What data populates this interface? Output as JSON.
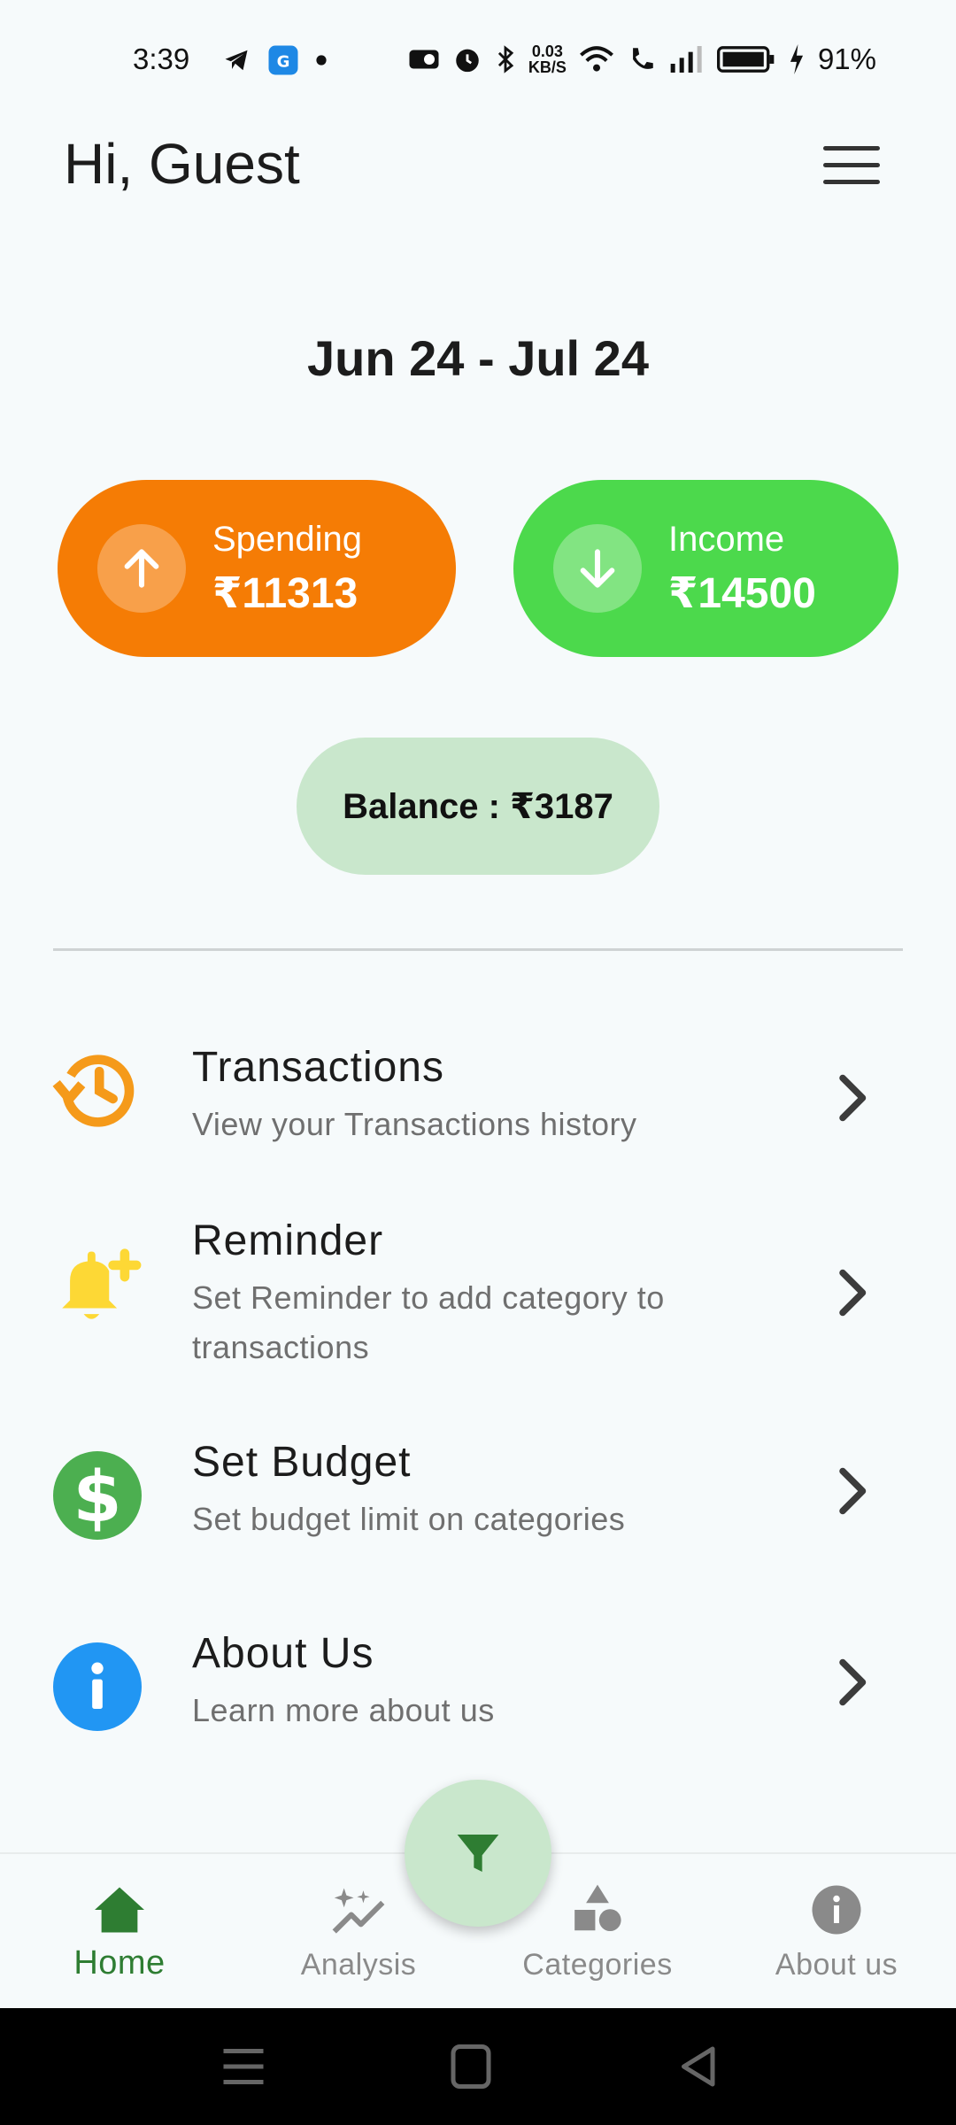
{
  "status_bar": {
    "time": "3:39",
    "speed_value": "0.03",
    "speed_unit": "KB/S",
    "battery": "91%"
  },
  "header": {
    "greeting": "Hi, Guest"
  },
  "summary": {
    "date_range": "Jun 24 - Jul 24",
    "spending_label": "Spending",
    "spending_amount": "₹11313",
    "income_label": "Income",
    "income_amount": "₹14500",
    "balance": "Balance : ₹3187"
  },
  "menu": {
    "items": [
      {
        "title": "Transactions",
        "subtitle": "View your Transactions history",
        "icon": "history-icon"
      },
      {
        "title": "Reminder",
        "subtitle": "Set Reminder to add category to transactions",
        "icon": "bell-plus-icon"
      },
      {
        "title": "Set Budget",
        "subtitle": "Set budget limit on categories",
        "icon": "dollar-circle-icon"
      },
      {
        "title": "About Us",
        "subtitle": "Learn more about us",
        "icon": "info-circle-icon"
      }
    ]
  },
  "bottom_nav": {
    "items": [
      {
        "label": "Home",
        "icon": "home-icon",
        "active": true
      },
      {
        "label": "Analysis",
        "icon": "analysis-icon",
        "active": false
      },
      {
        "label": "Categories",
        "icon": "categories-icon",
        "active": false
      },
      {
        "label": "About us",
        "icon": "info-icon",
        "active": false
      }
    ]
  },
  "colors": {
    "spending": "#f57c05",
    "income": "#4cd94c",
    "balance_bg": "#c9e7cc",
    "active_nav": "#2e7d32",
    "history_icon": "#f59a1a",
    "bell_icon": "#fdd835",
    "dollar_icon": "#4caf50",
    "info_icon": "#2196f3"
  }
}
